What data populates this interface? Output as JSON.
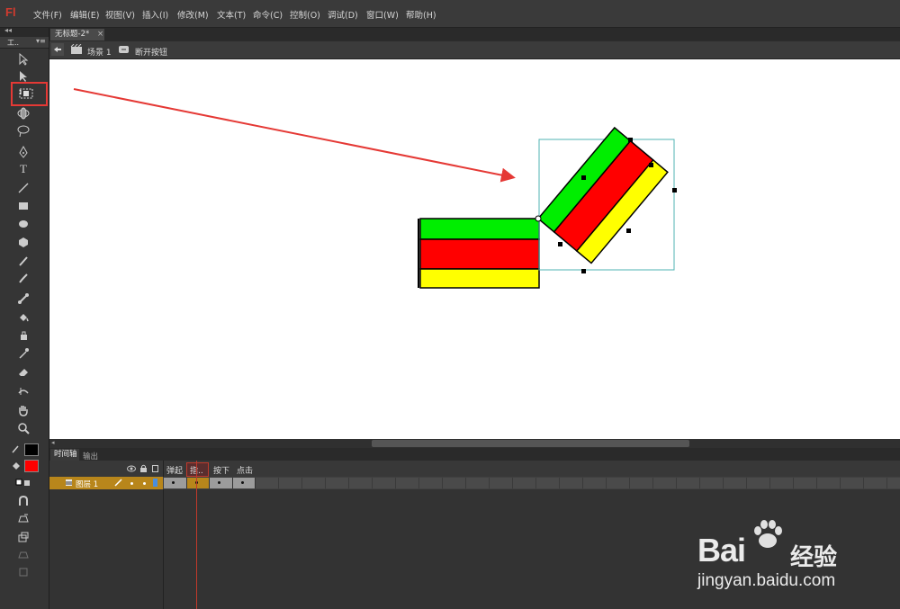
{
  "app": {
    "logo": "Fl"
  },
  "menu": [
    "文件(F)",
    "编辑(E)",
    "视图(V)",
    "插入(I)",
    "修改(M)",
    "文本(T)",
    "命令(C)",
    "控制(O)",
    "调试(D)",
    "窗口(W)",
    "帮助(H)"
  ],
  "tool_panel": {
    "title": "工.."
  },
  "document": {
    "tab": "无标题-2*",
    "tab_close": "×",
    "scene": "场景 1",
    "symbol": "断开按钮"
  },
  "timeline": {
    "tabs": [
      "时间轴",
      "输出"
    ],
    "frame_labels": [
      "弹起",
      "指..",
      "按下",
      "点击"
    ],
    "layer_name": "图层 1"
  },
  "colors": {
    "stroke": "#000000",
    "fill": "#ff0000",
    "stripe_top": "#00ee00",
    "stripe_mid": "#ff0000",
    "stripe_bottom": "#ffff00",
    "highlight": "#e53935"
  },
  "watermark": {
    "brand": "Bai",
    "brand_cn": "经验",
    "url": "jingyan.baidu.com"
  }
}
